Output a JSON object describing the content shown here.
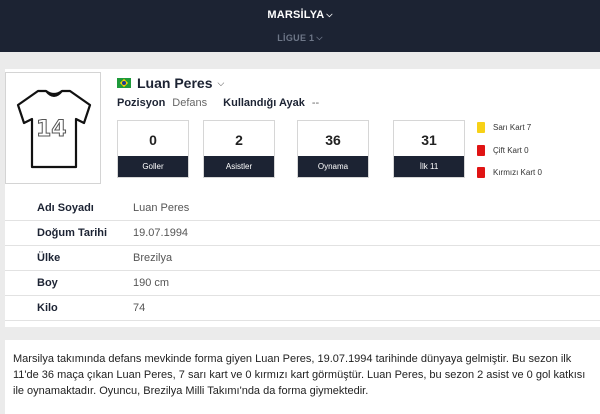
{
  "header": {
    "team": "MARSİLYA",
    "league": "LİGUE 1"
  },
  "player": {
    "jersey_number": "14",
    "flag_icon": "brazil-flag-icon",
    "name": "Luan Peres",
    "position_label": "Pozisyon",
    "position_value": "Defans",
    "foot_label": "Kullandığı Ayak",
    "foot_value": "--"
  },
  "stats": [
    {
      "value": "0",
      "label": "Goller"
    },
    {
      "value": "2",
      "label": "Asistler"
    },
    {
      "value": "36",
      "label": "Oynama"
    },
    {
      "value": "31",
      "label": "İlk 11"
    }
  ],
  "cards": [
    {
      "label": "Sarı Kart 7",
      "color": "#f7d117"
    },
    {
      "label": "Çift Kart 0",
      "color": "#e01414"
    },
    {
      "label": "Kırmızı Kart 0",
      "color": "#e01414"
    }
  ],
  "details": [
    {
      "key": "Adı Soyadı",
      "value": "Luan Peres"
    },
    {
      "key": "Doğum Tarihi",
      "value": "19.07.1994"
    },
    {
      "key": "Ülke",
      "value": "Brezilya"
    },
    {
      "key": "Boy",
      "value": "190 cm"
    },
    {
      "key": "Kilo",
      "value": "74"
    }
  ],
  "bio": "Marsilya takımında defans mevkinde forma giyen Luan Peres, 19.07.1994 tarihinde dünyaya gelmiştir. Bu sezon ilk 11'de 36 maça çıkan Luan Peres, 7 sarı kart ve 0 kırmızı kart görmüştür. Luan Peres, bu sezon 2 asist ve 0 gol katkısı ile oynamaktadır. Oyuncu, Brezilya Milli Takımı'nda da forma giymektedir.",
  "colors": {
    "navy": "#1c2333",
    "yellow_card": "#f7d117",
    "red_card": "#e01414"
  }
}
